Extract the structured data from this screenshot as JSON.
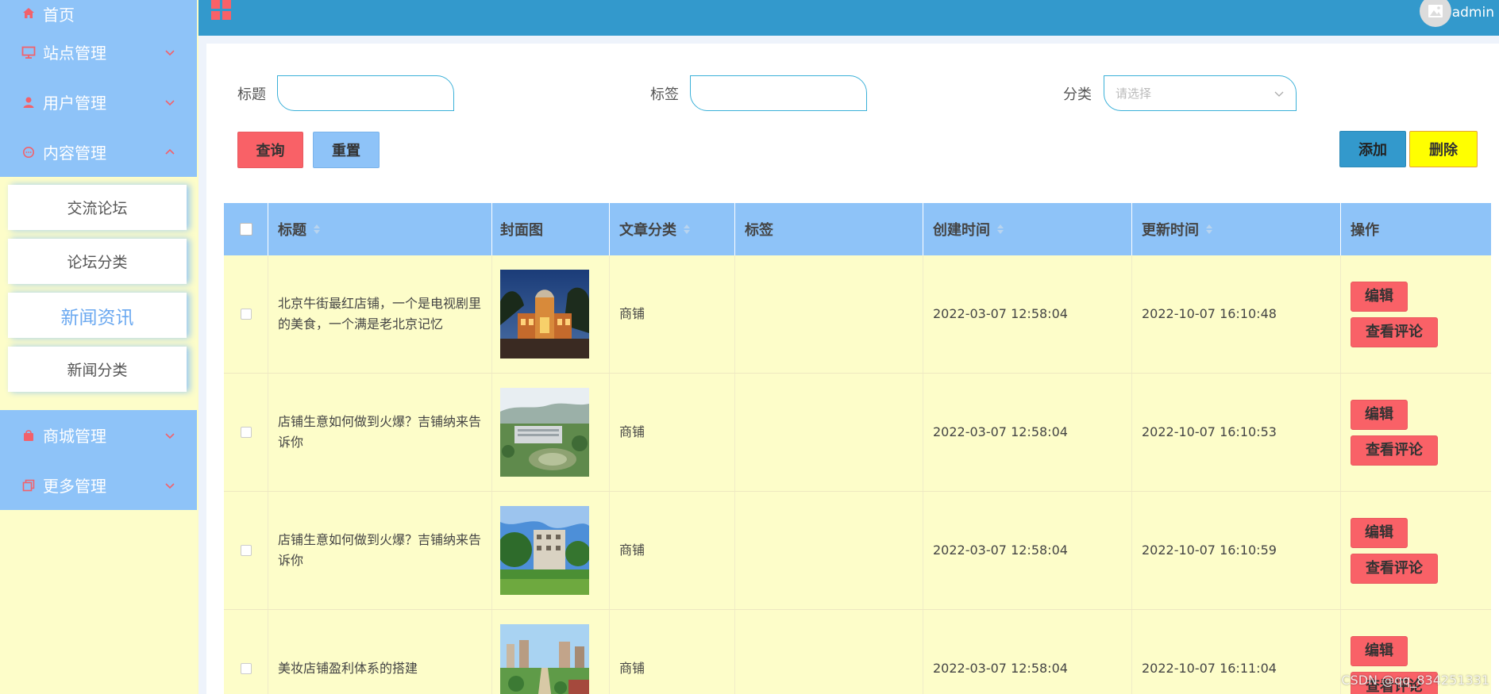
{
  "sidebar": {
    "items": [
      {
        "label": "首页",
        "icon": "home-icon"
      },
      {
        "label": "站点管理",
        "icon": "monitor-icon"
      },
      {
        "label": "用户管理",
        "icon": "user-icon"
      },
      {
        "label": "内容管理",
        "icon": "chat-icon"
      }
    ],
    "submenu": [
      "交流论坛",
      "论坛分类",
      "新闻资讯",
      "新闻分类"
    ],
    "active_sub": "新闻资讯",
    "bottom_items": [
      {
        "label": "商城管理",
        "icon": "bag-icon"
      },
      {
        "label": "更多管理",
        "icon": "copy-icon"
      }
    ]
  },
  "header": {
    "user": "admin"
  },
  "filters": {
    "title_label": "标题",
    "tag_label": "标签",
    "category_label": "分类",
    "category_placeholder": "请选择"
  },
  "actions": {
    "query": "查询",
    "reset": "重置",
    "add": "添加",
    "delete": "删除"
  },
  "table": {
    "headers": [
      "标题",
      "封面图",
      "文章分类",
      "标签",
      "创建时间",
      "更新时间",
      "操作"
    ],
    "rows": [
      {
        "title": "北京牛街最红店铺，一个是电视剧里的美食，一个满是老北京记忆",
        "category": "商铺",
        "tag": "",
        "created": "2022-03-07 12:58:04",
        "updated": "2022-10-07 16:10:48"
      },
      {
        "title": "店铺生意如何做到火爆？吉铺纳来告诉你",
        "category": "商铺",
        "tag": "",
        "created": "2022-03-07 12:58:04",
        "updated": "2022-10-07 16:10:53"
      },
      {
        "title": "店铺生意如何做到火爆？吉铺纳来告诉你",
        "category": "商铺",
        "tag": "",
        "created": "2022-03-07 12:58:04",
        "updated": "2022-10-07 16:10:59"
      },
      {
        "title": "美妆店铺盈利体系的搭建",
        "category": "商铺",
        "tag": "",
        "created": "2022-03-07 12:58:04",
        "updated": "2022-10-07 16:11:04"
      }
    ],
    "edit_label": "编辑",
    "view_comments_label": "查看评论"
  },
  "watermark": "CSDN @qq_834251331",
  "colors": {
    "sidebar_blue": "#8ec3f8",
    "header_blue": "#3399cc",
    "accent_red": "#f96167",
    "row_yellow": "#fdfdc9",
    "delete_yellow": "#ffff00"
  }
}
